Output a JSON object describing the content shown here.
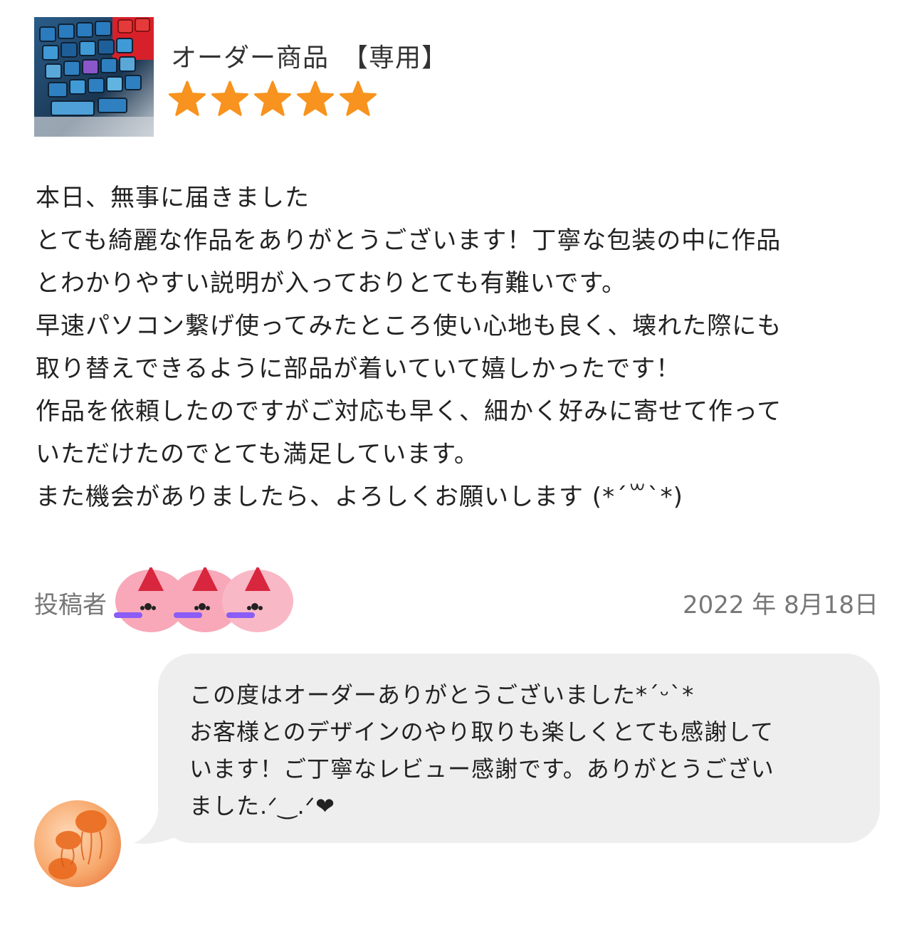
{
  "product": {
    "title": "オーダー商品　【専用】",
    "rating": 5,
    "star_color": "#F7931E"
  },
  "review": {
    "lines": [
      "本日、無事に届きました",
      "とても綺麗な作品をありがとうございます！丁寧な包装の中に作品",
      "とわかりやすい説明が入っておりとても有難いです。",
      "早速パソコン繋げ使ってみたところ使い心地も良く、壊れた際にも",
      "取り替えできるように部品が着いていて嬉しかったです！",
      "作品を依頼したのですがご対応も早く、細かく好みに寄せて作って",
      "いただけたのでとても満足しています。",
      "また機会がありましたら、よろしくお願いします (*´꒳`*)"
    ],
    "poster_label": "投稿者",
    "date": "2022 年 8月18日"
  },
  "reply": {
    "lines": [
      "この度はオーダーありがとうございました*ˊᵕˋ*",
      "お客様とのデザインのやり取りも楽しくとても感謝して",
      "います！ご丁寧なレビュー感謝です。ありがとうござい",
      "ました.ᐟ‿.ᐟ❤"
    ],
    "bubble_color": "#EEEEEE"
  },
  "icons": {
    "product": "keyboard-keycaps-photo",
    "poster": "pink-seal-santa-avatar",
    "seller": "jellyfish-avatar"
  }
}
